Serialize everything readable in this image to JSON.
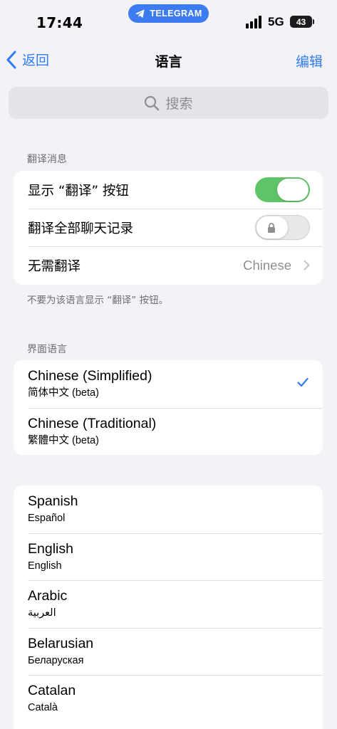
{
  "status_bar": {
    "time": "17:44",
    "pill_label": "TELEGRAM",
    "network": "5G",
    "battery": "43",
    "battery_level": 0.43
  },
  "nav": {
    "back_label": "返回",
    "title": "语言",
    "edit_label": "编辑"
  },
  "search": {
    "placeholder": "搜索"
  },
  "translate_section": {
    "header": "翻译消息",
    "rows": [
      {
        "label": "显示 “翻译” 按钮",
        "toggle": true
      },
      {
        "label": "翻译全部聊天记录",
        "toggle": false,
        "locked": true
      },
      {
        "label": "无需翻译",
        "value": "Chinese"
      }
    ],
    "footer": "不要为该语言显示 “翻译” 按钮。"
  },
  "interface_section": {
    "header": "界面语言",
    "items": [
      {
        "name": "Chinese (Simplified)",
        "native": "简体中文 (beta)",
        "selected": true
      },
      {
        "name": "Chinese (Traditional)",
        "native": "繁體中文 (beta)",
        "selected": false
      }
    ]
  },
  "languages": [
    {
      "name": "Spanish",
      "native": "Español"
    },
    {
      "name": "English",
      "native": "English"
    },
    {
      "name": "Arabic",
      "native": "العربية"
    },
    {
      "name": "Belarusian",
      "native": "Беларуская"
    },
    {
      "name": "Catalan",
      "native": "Català"
    }
  ],
  "colors": {
    "accent": "#2f7cf6",
    "toggle_on": "#5fc467",
    "background": "#f2f2f7",
    "telegram_pill": "#3d7bf0"
  },
  "icons": {
    "pill": "telegram-plane-icon",
    "back": "chevron-left-icon",
    "search": "search-icon",
    "lock": "lock-icon",
    "disclosure": "chevron-right-icon",
    "selected": "checkmark-icon"
  }
}
